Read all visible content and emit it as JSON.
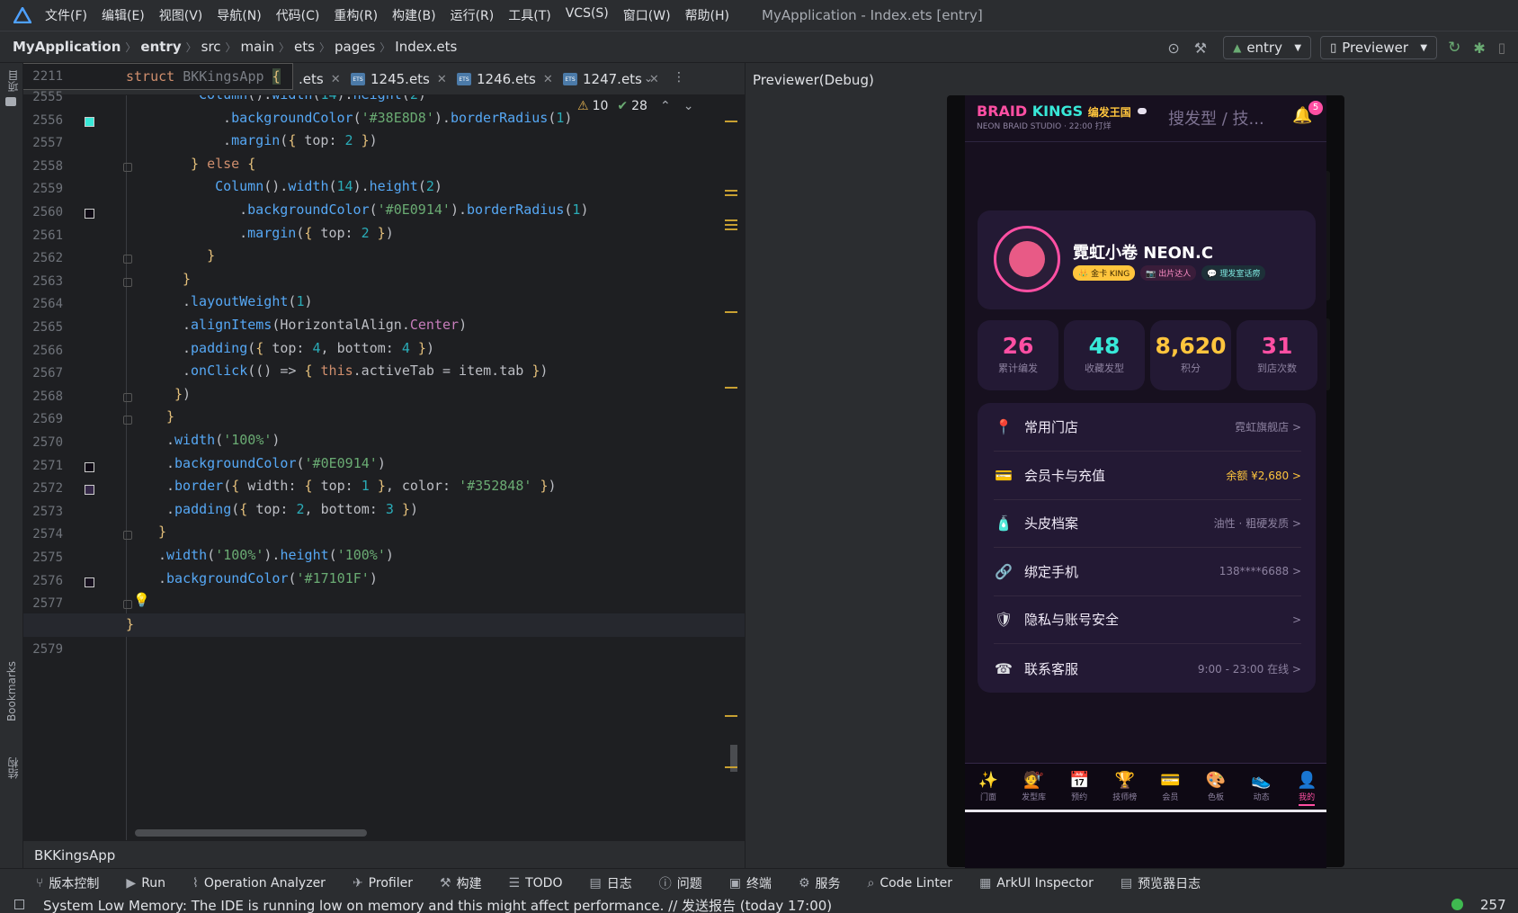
{
  "menubar": {
    "items": [
      "文件(F)",
      "编辑(E)",
      "视图(V)",
      "导航(N)",
      "代码(C)",
      "重构(R)",
      "构建(B)",
      "运行(R)",
      "工具(T)",
      "VCS(S)",
      "窗口(W)",
      "帮助(H)"
    ],
    "title": "MyApplication - Index.ets [entry]"
  },
  "navbar": {
    "crumbs": [
      "MyApplication",
      "entry",
      "src",
      "main",
      "ets",
      "pages",
      "Index.ets"
    ],
    "module": "entry",
    "device": "Previewer"
  },
  "leftstrip": {
    "top": "项目",
    "bookmarks": "Bookmarks",
    "structure": "结构"
  },
  "editor": {
    "sticky_line": "2211",
    "sticky_code": "struct BKKingsApp {",
    "tabs": [
      ".ets",
      "1245.ets",
      "1246.ets",
      "1247.ets"
    ],
    "warnings": "10",
    "checks": "28",
    "lines": [
      {
        "n": "2555",
        "html": "<span class='fn'>Column</span>().<span class='fn'>width</span>(<span class='num'>14</span>).<span class='fn'>height</span>(<span class='num'>2</span>)"
      },
      {
        "n": "2556",
        "html": "  .<span class='fn'>backgroundColor</span>(<span class='str'>'#38E8D8'</span>).<span class='fn'>borderRadius</span>(<span class='num'>1</span>)"
      },
      {
        "n": "2557",
        "html": "  .<span class='fn'>margin</span>(<span class='br'>{</span> top: <span class='num'>2</span> <span class='br'>}</span>)"
      },
      {
        "n": "2558",
        "html": "<span class='br'>}</span> <span class='kw'>else</span> <span class='br'>{</span>"
      },
      {
        "n": "2559",
        "html": "  <span class='fn'>Column</span>().<span class='fn'>width</span>(<span class='num'>14</span>).<span class='fn'>height</span>(<span class='num'>2</span>)"
      },
      {
        "n": "2560",
        "html": "    .<span class='fn'>backgroundColor</span>(<span class='str'>'#0E0914'</span>).<span class='fn'>borderRadius</span>(<span class='num'>1</span>)"
      },
      {
        "n": "2561",
        "html": "    .<span class='fn'>margin</span>(<span class='br'>{</span> top: <span class='num'>2</span> <span class='br'>}</span>)"
      },
      {
        "n": "2562",
        "html": "  <span class='br'>}</span>"
      },
      {
        "n": "2563",
        "html": "<span class='br'>}</span>"
      },
      {
        "n": "2564",
        "html": ".<span class='fn'>layoutWeight</span>(<span class='num'>1</span>)"
      },
      {
        "n": "2565",
        "html": ".<span class='fn'>alignItems</span>(HorizontalAlign.<span class='prop'>Center</span>)"
      },
      {
        "n": "2566",
        "html": ".<span class='fn'>padding</span>(<span class='br'>{</span> top: <span class='num'>4</span>, bottom: <span class='num'>4</span> <span class='br'>}</span>)"
      },
      {
        "n": "2567",
        "html": ".<span class='fn'>onClick</span>(() => <span class='br'>{</span> <span class='kw'>this</span>.activeTab = item.tab <span class='br'>}</span>)"
      },
      {
        "n": "2568",
        "html": "<span class='br'>}</span>)"
      },
      {
        "n": "2569",
        "html": "<span class='br'>}</span>"
      },
      {
        "n": "2570",
        "html": ".<span class='fn'>width</span>(<span class='str'>'100%'</span>)"
      },
      {
        "n": "2571",
        "html": ".<span class='fn'>backgroundColor</span>(<span class='str'>'#0E0914'</span>)"
      },
      {
        "n": "2572",
        "html": ".<span class='fn'>border</span>(<span class='br'>{</span> width: <span class='br'>{</span> top: <span class='num'>1</span> <span class='br'>}</span>, color: <span class='str'>'#352848'</span> <span class='br'>}</span>)"
      },
      {
        "n": "2573",
        "html": ".<span class='fn'>padding</span>(<span class='br'>{</span> top: <span class='num'>2</span>, bottom: <span class='num'>3</span> <span class='br'>}</span>)"
      },
      {
        "n": "2574",
        "html": "<span class='br'>}</span>"
      },
      {
        "n": "2575",
        "html": ".<span class='fn'>width</span>(<span class='str'>'100%'</span>).<span class='fn'>height</span>(<span class='str'>'100%'</span>)"
      },
      {
        "n": "2576",
        "html": ".<span class='fn'>backgroundColor</span>(<span class='str'>'#17101F'</span>)"
      },
      {
        "n": "2577",
        "html": ""
      },
      {
        "n": "2578",
        "html": "<span class='br'>}</span>"
      },
      {
        "n": "2579",
        "html": ""
      }
    ],
    "bottom_crumb": "BKKingsApp"
  },
  "toolwindows": [
    "版本控制",
    "Run",
    "Operation Analyzer",
    "Profiler",
    "构建",
    "TODO",
    "日志",
    "问题",
    "终端",
    "服务",
    "Code Linter",
    "ArkUI Inspector",
    "预览器日志"
  ],
  "status": {
    "message": "System Low Memory: The IDE is running low on memory and this might affect performance. // 发送报告 (today 17:00)",
    "right": "257"
  },
  "preview": {
    "header": "Previewer(Debug)",
    "app": {
      "brand_a": "BRAID",
      "brand_b": "KINGS",
      "brand_cn": "编发王国",
      "subtitle": "NEON BRAID STUDIO · 22:00 打烊",
      "search": "搜发型 / 技...",
      "notif_count": "5",
      "profile": {
        "name": "霓虹小卷 NEON.C",
        "badges": [
          "👑 金卡 KING",
          "📷 出片达人",
          "💬 理发室话痨"
        ]
      },
      "stats": [
        {
          "num": "26",
          "label": "累计编发",
          "color": "#ff4fa3"
        },
        {
          "num": "48",
          "label": "收藏发型",
          "color": "#38e8d8"
        },
        {
          "num": "8,620",
          "label": "积分",
          "color": "#ffc53d"
        },
        {
          "num": "31",
          "label": "到店次数",
          "color": "#ff4fa3"
        }
      ],
      "rows": [
        {
          "icon": "📍",
          "label": "常用门店",
          "value": "霓虹旗舰店 >",
          "vcolor": "#8d82a0"
        },
        {
          "icon": "💳",
          "label": "会员卡与充值",
          "value": "余额 ¥2,680 >",
          "vcolor": "#ffc53d"
        },
        {
          "icon": "🧴",
          "label": "头皮档案",
          "value": "油性 · 粗硬发质 >",
          "vcolor": "#8d82a0"
        },
        {
          "icon": "🔗",
          "label": "绑定手机",
          "value": "138****6688 >",
          "vcolor": "#8d82a0"
        },
        {
          "icon": "🛡",
          "label": "隐私与账号安全",
          "value": ">",
          "vcolor": "#8d82a0"
        },
        {
          "icon": "☎",
          "label": "联系客服",
          "value": "9:00 - 23:00 在线 >",
          "vcolor": "#8d82a0"
        }
      ],
      "nav": [
        {
          "icon": "✨",
          "label": "门面"
        },
        {
          "icon": "💇",
          "label": "发型库"
        },
        {
          "icon": "📅",
          "label": "预约"
        },
        {
          "icon": "🏆",
          "label": "技师榜"
        },
        {
          "icon": "💳",
          "label": "会员"
        },
        {
          "icon": "🎨",
          "label": "色板"
        },
        {
          "icon": "👟",
          "label": "动态"
        },
        {
          "icon": "👤",
          "label": "我的"
        }
      ],
      "active_nav": "我的"
    }
  }
}
